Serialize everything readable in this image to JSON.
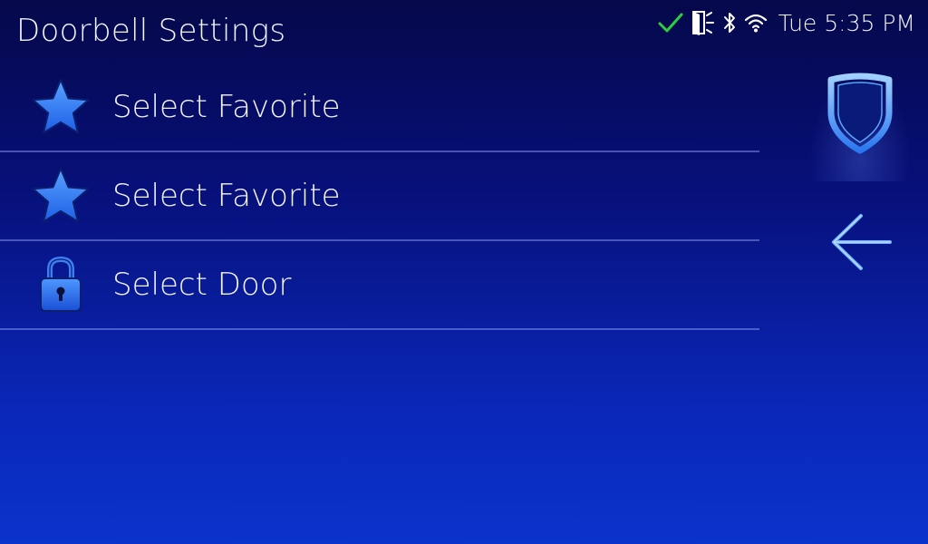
{
  "header": {
    "title": "Doorbell Settings"
  },
  "status_bar": {
    "time": "Tue 5:35 PM",
    "icons": [
      "check-icon",
      "door-sensor-icon",
      "bluetooth-icon",
      "wifi-icon"
    ],
    "check_color": "#2ecc40"
  },
  "menu": {
    "items": [
      {
        "label": "Select Favorite",
        "icon": "star-icon"
      },
      {
        "label": "Select Favorite",
        "icon": "star-icon"
      },
      {
        "label": "Select Door",
        "icon": "lock-icon"
      }
    ]
  },
  "side_buttons": {
    "security": {
      "icon": "shield-icon"
    },
    "back": {
      "icon": "back-arrow-icon"
    }
  },
  "colors": {
    "background_top": "#05084a",
    "background_bottom": "#0a33cc",
    "accent_blue": "#3a86ff"
  }
}
